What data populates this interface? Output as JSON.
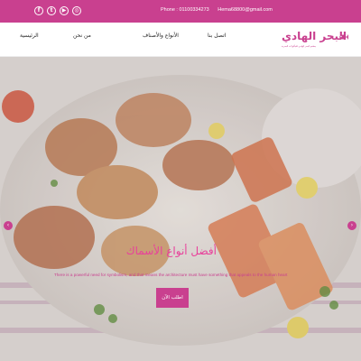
{
  "topbar": {
    "socials": [
      {
        "icon": "facebook-icon",
        "glyph": "f"
      },
      {
        "icon": "twitter-icon",
        "glyph": "t"
      },
      {
        "icon": "youtube-icon",
        "glyph": "▶"
      },
      {
        "icon": "instagram-icon",
        "glyph": "◎"
      }
    ],
    "phone": "Phone : 01100334273",
    "email": "Hema68800@gmail.com"
  },
  "header": {
    "logo_text": "البحر الهادي",
    "logo_subtitle": "مطعم البحر الهادي للمأكولات البحرية",
    "nav": {
      "home": "الرئيسية",
      "about": "من نحن",
      "types": "الأنواع والأصناف",
      "contact": "اتصل بنا"
    }
  },
  "hero": {
    "title": "أفضل أنواع الأسماك",
    "text": "There is a powerful need for symbolism, and that means the architecture must have something that appeals to the human heart",
    "button": "اطلب الآن",
    "arrow_left": "‹",
    "arrow_right": "›"
  },
  "colors": {
    "accent": "#c9408f",
    "title": "#e8419b"
  }
}
